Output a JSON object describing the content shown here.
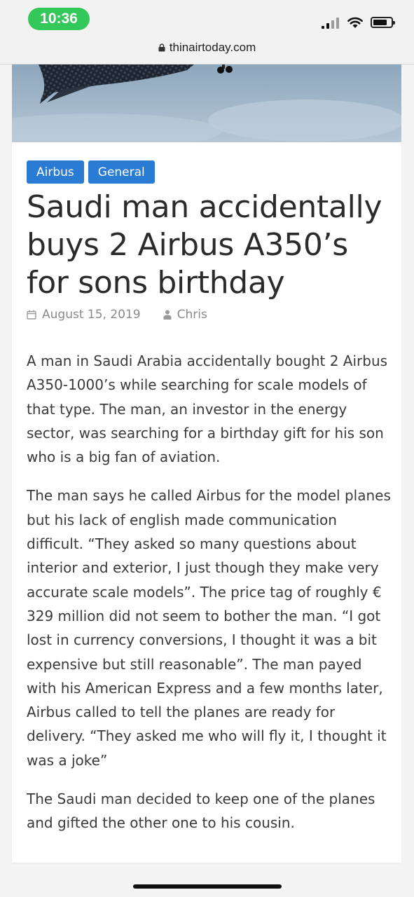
{
  "status_bar": {
    "time": "10:36"
  },
  "browser": {
    "url": "thinairtoday.com"
  },
  "article": {
    "tags": [
      "Airbus",
      "General"
    ],
    "title": "Saudi man accidentally buys 2 Airbus A350’s for sons birthday",
    "date": "August 15, 2019",
    "author": "Chris",
    "paragraphs": [
      "A man in Saudi Arabia accidentally bought 2 Airbus A350-1000’s while searching for scale models of that type. The man, an investor in the energy sector, was searching for a birthday gift for his son who is a big fan of aviation.",
      "The man says he called Airbus for the model planes but his lack of english made communication difficult. “They asked so many questions about interior and exterior, I just though they make very accurate scale models”. The price tag of roughly € 329 million did not seem to bother the man. “I got lost in currency conversions, I thought it was a bit expensive but still reasonable”. The man payed with his American Express and a few months later, Airbus called to tell the planes are ready for delivery. “They asked me who will fly it, I thought it was a joke”",
      "The Saudi man decided to keep one of the planes and gifted the other one to his cousin."
    ]
  },
  "colors": {
    "tag_bg": "#2a7bd4",
    "time_pill": "#34c759"
  }
}
